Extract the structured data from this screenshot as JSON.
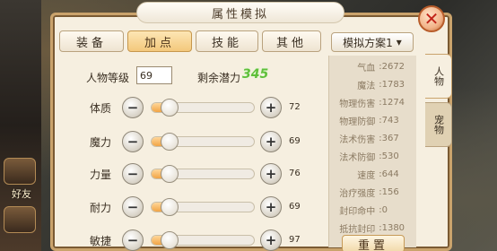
{
  "window": {
    "title": "属性模拟",
    "close_label": "✕"
  },
  "tabs": [
    {
      "label": "装备",
      "active": false
    },
    {
      "label": "加点",
      "active": true
    },
    {
      "label": "技能",
      "active": false
    },
    {
      "label": "其他",
      "active": false
    }
  ],
  "scheme": {
    "label": "模拟方案1",
    "arrow": "▾"
  },
  "level": {
    "label": "人物等级",
    "value": "69"
  },
  "potential": {
    "label": "剩余潜力",
    "value": "345"
  },
  "attributes": [
    {
      "label": "体质",
      "value": "72",
      "fill": 0.14
    },
    {
      "label": "魔力",
      "value": "69",
      "fill": 0.14
    },
    {
      "label": "力量",
      "value": "76",
      "fill": 0.14
    },
    {
      "label": "耐力",
      "value": "69",
      "fill": 0.14
    },
    {
      "label": "敏捷",
      "value": "97",
      "fill": 0.14
    }
  ],
  "stats": [
    {
      "label": "气血",
      "value": "2672"
    },
    {
      "label": "魔法",
      "value": "1783"
    },
    {
      "label": "物理伤害",
      "value": "1274"
    },
    {
      "label": "物理防御",
      "value": "743"
    },
    {
      "label": "法术伤害",
      "value": "367"
    },
    {
      "label": "法术防御",
      "value": "530"
    },
    {
      "label": "速度",
      "value": "644"
    },
    {
      "label": "治疗强度",
      "value": "156"
    },
    {
      "label": "封印命中",
      "value": "0"
    },
    {
      "label": "抵抗封印",
      "value": "1380"
    }
  ],
  "reset_label": "重置",
  "side_tabs": [
    {
      "label": "人物",
      "active": true
    },
    {
      "label": "宠物",
      "active": false
    }
  ],
  "left_bar": {
    "friends_label": "好友"
  },
  "buttons": {
    "minus": "−",
    "plus": "+"
  }
}
